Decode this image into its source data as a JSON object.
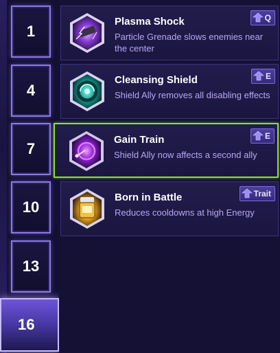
{
  "levels": [
    {
      "label": "1"
    },
    {
      "label": "4"
    },
    {
      "label": "7"
    },
    {
      "label": "10"
    },
    {
      "label": "13"
    },
    {
      "label": "16"
    }
  ],
  "talents": [
    {
      "name": "Plasma Shock",
      "description": "Particle Grenade slows enemies near the center",
      "hotkey": "Q",
      "icon": "plasma-shock-icon",
      "accent": "#a25cf0"
    },
    {
      "name": "Cleansing Shield",
      "description": "Shield Ally removes all disabling effects",
      "hotkey": "E",
      "icon": "cleansing-shield-icon",
      "accent": "#21c7b8"
    },
    {
      "name": "Gain Train",
      "description": "Shield Ally now affects a second ally",
      "hotkey": "E",
      "icon": "gain-train-icon",
      "accent": "#b23cf0"
    },
    {
      "name": "Born in Battle",
      "description": "Reduces cooldowns at high Energy",
      "hotkey": "Trait",
      "icon": "born-in-battle-icon",
      "accent": "#f0b12a"
    }
  ],
  "colors": {
    "selected_border": "#8ce028",
    "level_border": "#8d7ae0",
    "description_text": "#b7a9f0"
  }
}
